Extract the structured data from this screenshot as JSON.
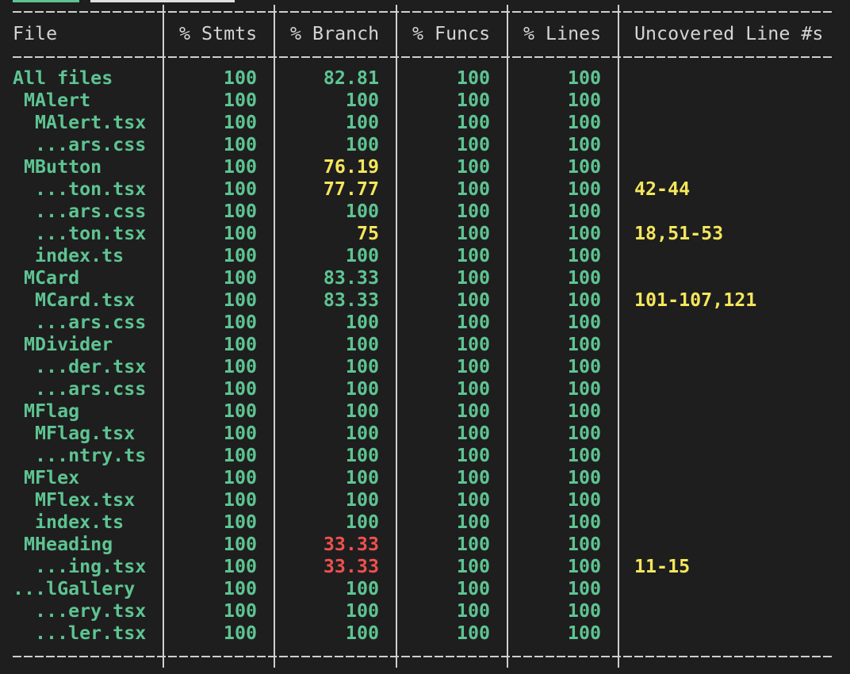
{
  "headers": {
    "file": "File",
    "stmts": "% Stmts",
    "branch": "% Branch",
    "funcs": "% Funcs",
    "lines": "% Lines",
    "uncovered": "Uncovered Line #s"
  },
  "status_colors": {
    "high": "#5ec492",
    "medium": "#f5e65b",
    "low": "#f0504f"
  },
  "rows": [
    {
      "file": "All files",
      "indent": 0,
      "stmts": "100",
      "branch": "82.81",
      "branch_level": "high",
      "funcs": "100",
      "lines": "100",
      "uncovered": ""
    },
    {
      "file": "MAlert",
      "indent": 1,
      "stmts": "100",
      "branch": "100",
      "branch_level": "high",
      "funcs": "100",
      "lines": "100",
      "uncovered": ""
    },
    {
      "file": "MAlert.tsx",
      "indent": 2,
      "stmts": "100",
      "branch": "100",
      "branch_level": "high",
      "funcs": "100",
      "lines": "100",
      "uncovered": ""
    },
    {
      "file": "...ars.css",
      "indent": 2,
      "stmts": "100",
      "branch": "100",
      "branch_level": "high",
      "funcs": "100",
      "lines": "100",
      "uncovered": ""
    },
    {
      "file": "MButton",
      "indent": 1,
      "stmts": "100",
      "branch": "76.19",
      "branch_level": "medium",
      "funcs": "100",
      "lines": "100",
      "uncovered": ""
    },
    {
      "file": "...ton.tsx",
      "indent": 2,
      "stmts": "100",
      "branch": "77.77",
      "branch_level": "medium",
      "funcs": "100",
      "lines": "100",
      "uncovered": "42-44"
    },
    {
      "file": "...ars.css",
      "indent": 2,
      "stmts": "100",
      "branch": "100",
      "branch_level": "high",
      "funcs": "100",
      "lines": "100",
      "uncovered": ""
    },
    {
      "file": "...ton.tsx",
      "indent": 2,
      "stmts": "100",
      "branch": "75",
      "branch_level": "medium",
      "funcs": "100",
      "lines": "100",
      "uncovered": "18,51-53"
    },
    {
      "file": "index.ts",
      "indent": 2,
      "stmts": "100",
      "branch": "100",
      "branch_level": "high",
      "funcs": "100",
      "lines": "100",
      "uncovered": ""
    },
    {
      "file": "MCard",
      "indent": 1,
      "stmts": "100",
      "branch": "83.33",
      "branch_level": "high",
      "funcs": "100",
      "lines": "100",
      "uncovered": ""
    },
    {
      "file": "MCard.tsx",
      "indent": 2,
      "stmts": "100",
      "branch": "83.33",
      "branch_level": "high",
      "funcs": "100",
      "lines": "100",
      "uncovered": "101-107,121"
    },
    {
      "file": "...ars.css",
      "indent": 2,
      "stmts": "100",
      "branch": "100",
      "branch_level": "high",
      "funcs": "100",
      "lines": "100",
      "uncovered": ""
    },
    {
      "file": "MDivider",
      "indent": 1,
      "stmts": "100",
      "branch": "100",
      "branch_level": "high",
      "funcs": "100",
      "lines": "100",
      "uncovered": ""
    },
    {
      "file": "...der.tsx",
      "indent": 2,
      "stmts": "100",
      "branch": "100",
      "branch_level": "high",
      "funcs": "100",
      "lines": "100",
      "uncovered": ""
    },
    {
      "file": "...ars.css",
      "indent": 2,
      "stmts": "100",
      "branch": "100",
      "branch_level": "high",
      "funcs": "100",
      "lines": "100",
      "uncovered": ""
    },
    {
      "file": "MFlag",
      "indent": 1,
      "stmts": "100",
      "branch": "100",
      "branch_level": "high",
      "funcs": "100",
      "lines": "100",
      "uncovered": ""
    },
    {
      "file": "MFlag.tsx",
      "indent": 2,
      "stmts": "100",
      "branch": "100",
      "branch_level": "high",
      "funcs": "100",
      "lines": "100",
      "uncovered": ""
    },
    {
      "file": "...ntry.ts",
      "indent": 2,
      "stmts": "100",
      "branch": "100",
      "branch_level": "high",
      "funcs": "100",
      "lines": "100",
      "uncovered": ""
    },
    {
      "file": "MFlex",
      "indent": 1,
      "stmts": "100",
      "branch": "100",
      "branch_level": "high",
      "funcs": "100",
      "lines": "100",
      "uncovered": ""
    },
    {
      "file": "MFlex.tsx",
      "indent": 2,
      "stmts": "100",
      "branch": "100",
      "branch_level": "high",
      "funcs": "100",
      "lines": "100",
      "uncovered": ""
    },
    {
      "file": "index.ts",
      "indent": 2,
      "stmts": "100",
      "branch": "100",
      "branch_level": "high",
      "funcs": "100",
      "lines": "100",
      "uncovered": ""
    },
    {
      "file": "MHeading",
      "indent": 1,
      "stmts": "100",
      "branch": "33.33",
      "branch_level": "low",
      "funcs": "100",
      "lines": "100",
      "uncovered": ""
    },
    {
      "file": "...ing.tsx",
      "indent": 2,
      "stmts": "100",
      "branch": "33.33",
      "branch_level": "low",
      "funcs": "100",
      "lines": "100",
      "uncovered": "11-15"
    },
    {
      "file": "...lGallery",
      "indent": 0,
      "stmts": "100",
      "branch": "100",
      "branch_level": "high",
      "funcs": "100",
      "lines": "100",
      "uncovered": ""
    },
    {
      "file": "...ery.tsx",
      "indent": 2,
      "stmts": "100",
      "branch": "100",
      "branch_level": "high",
      "funcs": "100",
      "lines": "100",
      "uncovered": ""
    },
    {
      "file": "...ler.tsx",
      "indent": 2,
      "stmts": "100",
      "branch": "100",
      "branch_level": "high",
      "funcs": "100",
      "lines": "100",
      "uncovered": ""
    }
  ]
}
